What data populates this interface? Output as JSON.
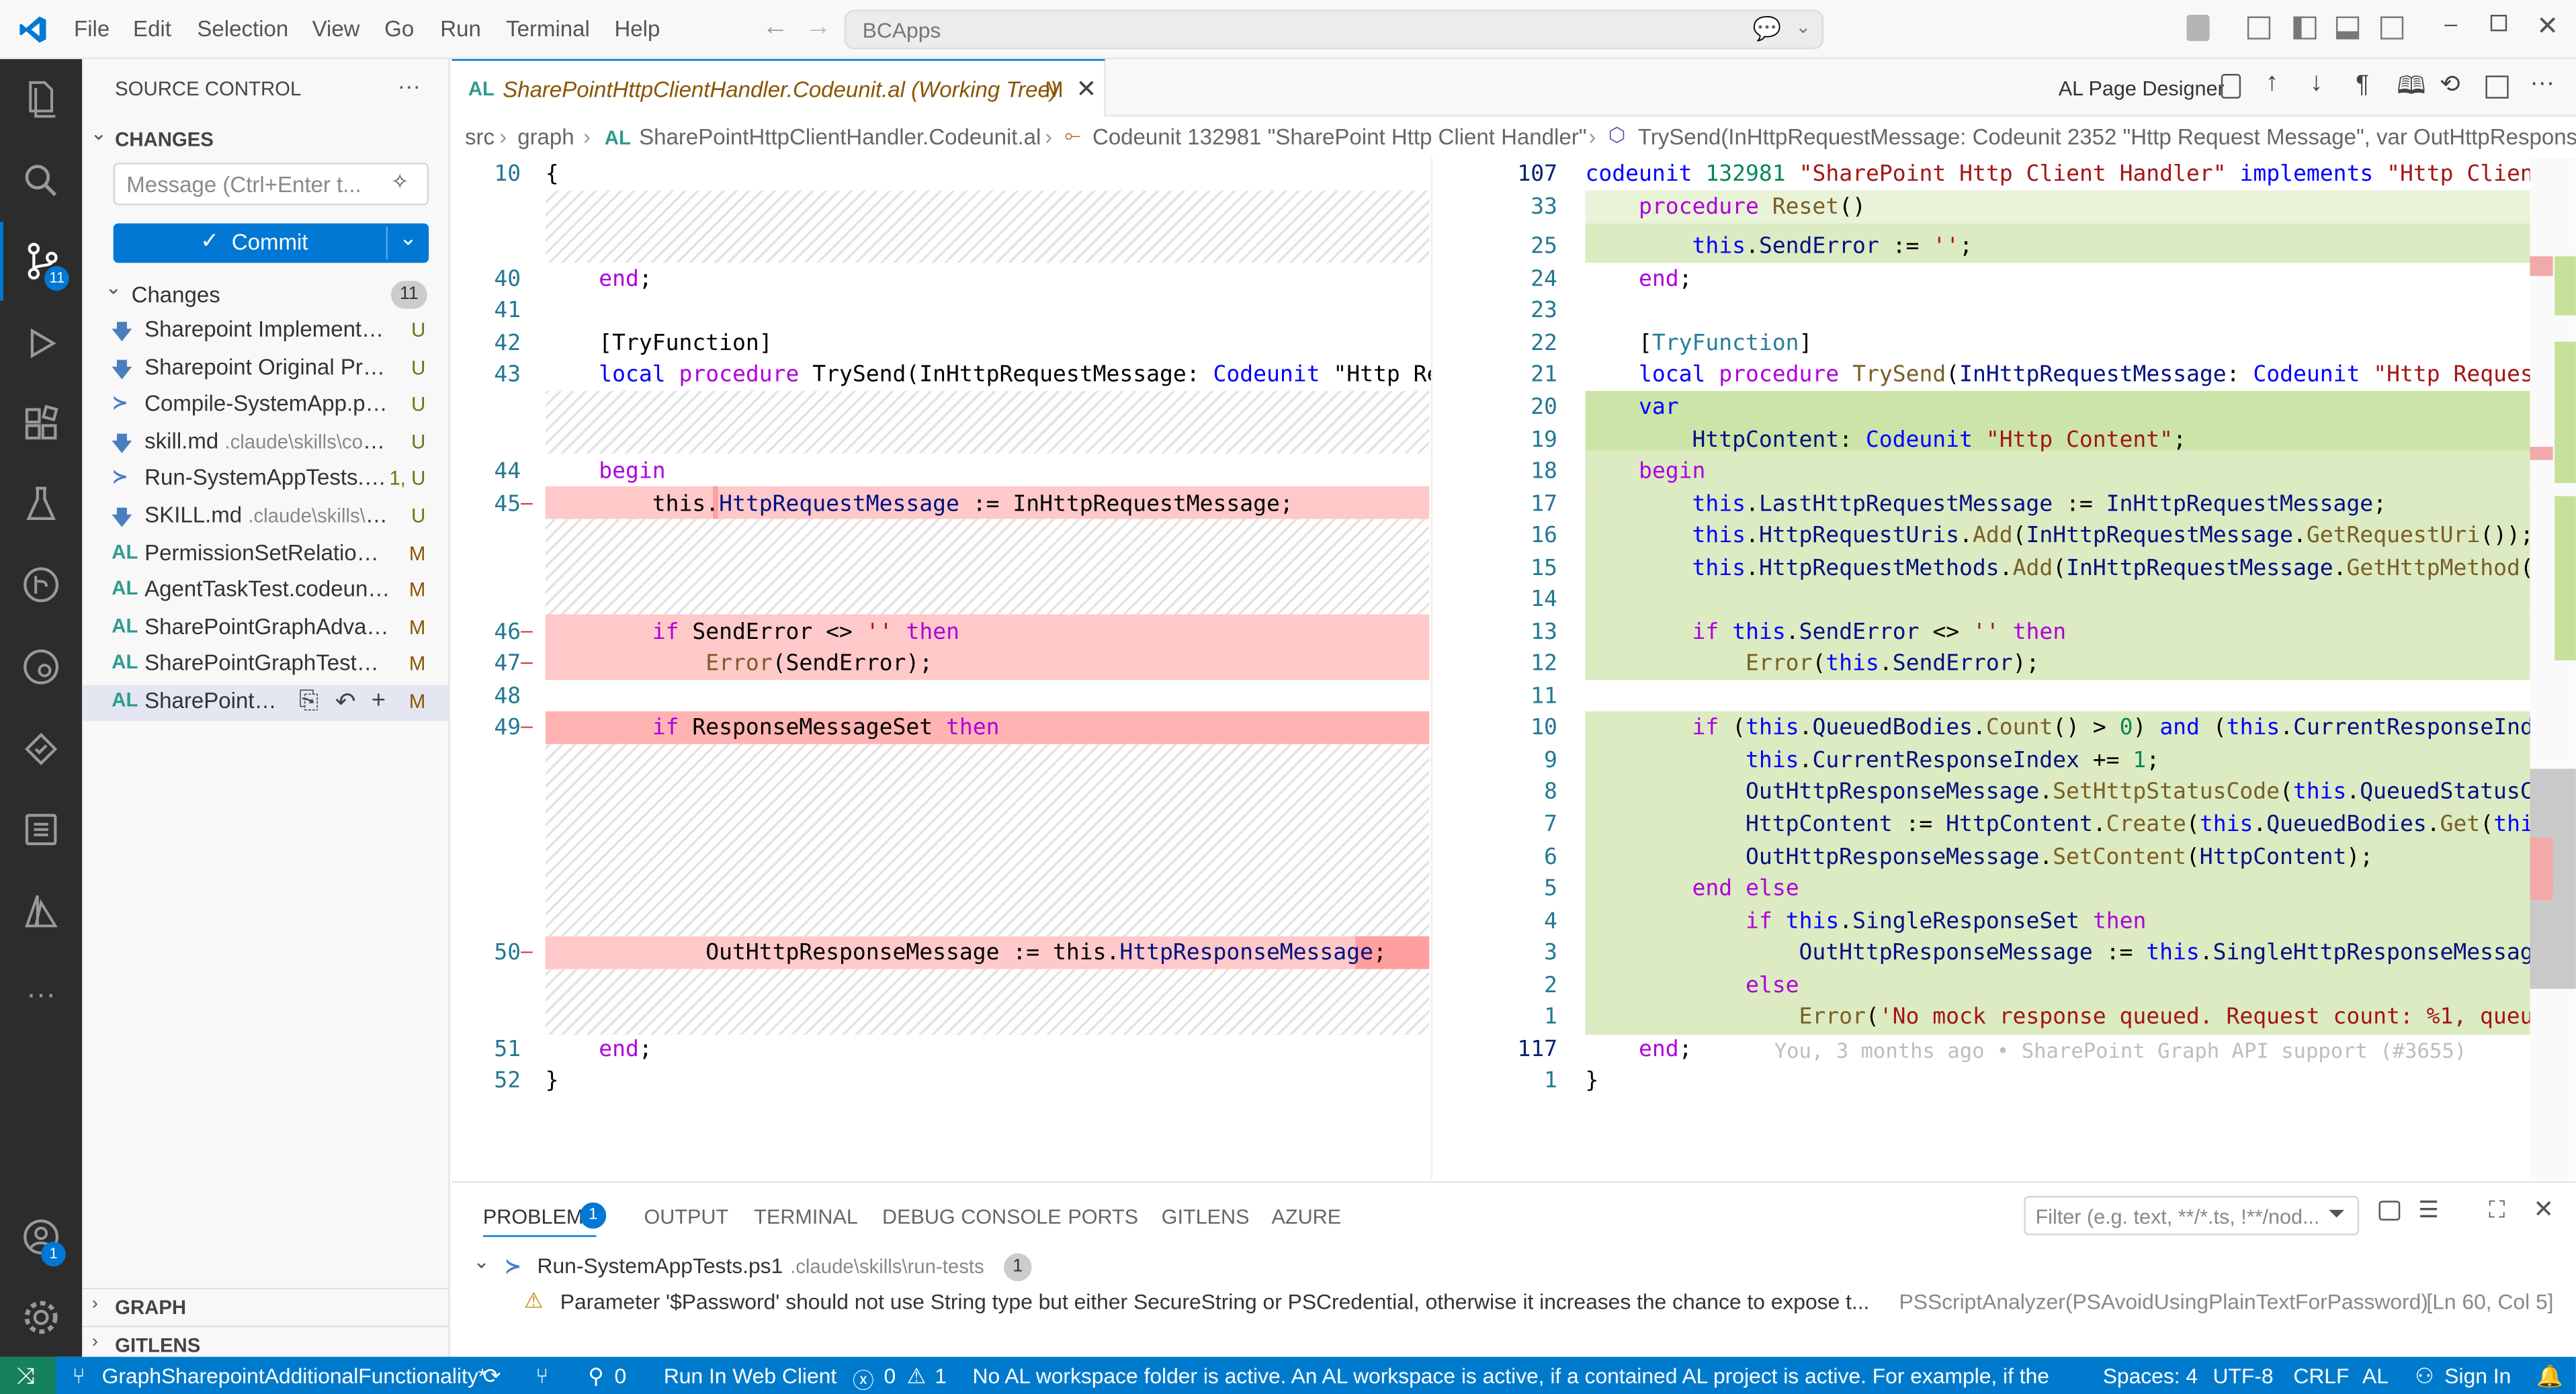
{
  "titlebar": {
    "menus": [
      "File",
      "Edit",
      "Selection",
      "View",
      "Go",
      "Run",
      "Terminal",
      "Help"
    ],
    "search_text": "BCApps"
  },
  "activity": {
    "scm_badge": "11",
    "accounts_badge": "1"
  },
  "sidebar": {
    "title": "SOURCE CONTROL",
    "more": "···",
    "changes_section": "CHANGES",
    "message_placeholder": "Message (Ctrl+Enter t...",
    "commit_label": "Commit",
    "changes_group": "Changes",
    "changes_count": "11",
    "files": [
      {
        "icon": "markdown-icon",
        "glyph": "🡇",
        "name": "Sharepoint Implementat...",
        "path": "",
        "status": "U",
        "status_class": "st-u",
        "icon_color": "#4a7fbf"
      },
      {
        "icon": "markdown-icon",
        "glyph": "🡇",
        "name": "Sharepoint Original Pro...",
        "path": "",
        "status": "U",
        "status_class": "st-u",
        "icon_color": "#4a7fbf"
      },
      {
        "icon": "powershell-icon",
        "glyph": "≻",
        "name": "Compile-SystemApp.ps1...",
        "path": "",
        "status": "U",
        "status_class": "st-u",
        "icon_color": "#4a7fbf"
      },
      {
        "icon": "markdown-icon",
        "glyph": "🡇",
        "name": "skill.md",
        "path": ".claude\\skills\\com...",
        "status": "U",
        "status_class": "st-u",
        "icon_color": "#4a7fbf"
      },
      {
        "icon": "powershell-icon",
        "glyph": "≻",
        "name": "Run-SystemAppTests.p...",
        "path": "",
        "status": "1, U",
        "status_class": "st-u",
        "icon_color": "#4a7fbf"
      },
      {
        "icon": "markdown-icon",
        "glyph": "🡇",
        "name": "SKILL.md",
        "path": ".claude\\skills\\ru...",
        "status": "U",
        "status_class": "st-u",
        "icon_color": "#4a7fbf"
      },
      {
        "icon": "al-icon",
        "glyph": "AL",
        "name": "PermissionSetRelationI...",
        "path": "",
        "status": "M",
        "status_class": "st-m",
        "icon_color": "#2f9a8f"
      },
      {
        "icon": "al-icon",
        "glyph": "AL",
        "name": "AgentTaskTest.codeunit....",
        "path": "",
        "status": "M",
        "status_class": "st-m",
        "icon_color": "#2f9a8f"
      },
      {
        "icon": "al-icon",
        "glyph": "AL",
        "name": "SharePointGraphAdvan...",
        "path": "",
        "status": "M",
        "status_class": "st-m",
        "icon_color": "#2f9a8f"
      },
      {
        "icon": "al-icon",
        "glyph": "AL",
        "name": "SharePointGraphTestLib...",
        "path": "",
        "status": "M",
        "status_class": "st-m",
        "icon_color": "#2f9a8f"
      },
      {
        "icon": "al-icon",
        "glyph": "AL",
        "name": "SharePointHt...",
        "path": "",
        "status": "M",
        "status_class": "st-m",
        "icon_color": "#2f9a8f"
      }
    ],
    "graph_section": "GRAPH",
    "gitlens_section": "GITLENS"
  },
  "editor": {
    "tab_lang": "AL",
    "tab_title": "SharePointHttpClientHandler.Codeunit.al (Working Tree)",
    "tab_status": "M",
    "designer_label": "AL Page Designer",
    "breadcrumb": {
      "src": "src",
      "graph": "graph",
      "file_lang": "AL",
      "file": "SharePointHttpClientHandler.Codeunit.al",
      "codeunit": "Codeunit 132981 \"SharePoint Http Client Handler\"",
      "method": "TrySend(InHttpRequestMessage: Codeunit 2352 \"Http Request Message\", var OutHttpResponseMessage"
    },
    "left_lines": [
      "10",
      "40",
      "41",
      "42",
      "43",
      "44",
      "45",
      "46",
      "47",
      "48",
      "49",
      "50",
      "51",
      "52"
    ],
    "right_lines": [
      "107",
      "33",
      "25",
      "24",
      "23",
      "22",
      "21",
      "20",
      "19",
      "18",
      "17",
      "16",
      "15",
      "14",
      "13",
      "12",
      "11",
      "10",
      "9",
      "8",
      "7",
      "6",
      "5",
      "4",
      "3",
      "2",
      "1",
      "117",
      "1"
    ],
    "blame": "You, 3 months ago • SharePoint Graph API support (#3655)"
  },
  "panel": {
    "tabs": [
      "PROBLEMS",
      "OUTPUT",
      "TERMINAL",
      "DEBUG CONSOLE",
      "PORTS",
      "GITLENS",
      "AZURE"
    ],
    "problems_count": "1",
    "filter_placeholder": "Filter (e.g. text, **/*.ts, !**/nod...",
    "problem_file": "Run-SystemAppTests.ps1",
    "problem_path": ".claude\\skills\\run-tests",
    "problem_file_count": "1",
    "problem_message": "Parameter '$Password' should not use String type but either SecureString or PSCredential, otherwise it increases the chance to expose t...",
    "problem_source": "PSScriptAnalyzer(PSAvoidUsingPlainTextForPassword)",
    "problem_location": "[Ln 60, Col 5]"
  },
  "statusbar": {
    "branch": "GraphSharepointAdditionalFunctionality*",
    "ports": "0",
    "run_web": "Run In Web Client",
    "errors": "0",
    "warnings": "1",
    "message": "No AL workspace folder is active. An AL workspace is active, if a contained AL project is active. For example, if the",
    "spaces": "Spaces: 4",
    "encoding": "UTF-8",
    "eol": "CRLF",
    "language": "AL",
    "signin": "Sign In"
  }
}
